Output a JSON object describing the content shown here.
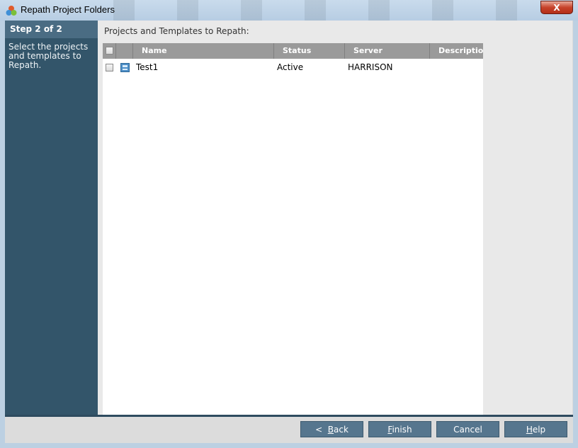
{
  "window": {
    "title": "Repath Project Folders",
    "close_label": "X"
  },
  "sidebar": {
    "step": "Step 2 of 2",
    "description": "Select the projects and templates to Repath."
  },
  "main": {
    "section_label": "Projects and Templates to Repath:",
    "columns": [
      "Name",
      "Status",
      "Server",
      "Description"
    ],
    "rows": [
      {
        "name": "Test1",
        "status": "Active",
        "server": "HARRISON",
        "description": "",
        "checked": false
      }
    ]
  },
  "buttons": {
    "back": {
      "prefix": "<",
      "mnemonic": "B",
      "rest": "ack"
    },
    "finish": {
      "mnemonic": "F",
      "rest": "inish"
    },
    "cancel": {
      "label": "Cancel"
    },
    "help": {
      "mnemonic": "H",
      "rest": "elp"
    }
  },
  "colors": {
    "sidebar": "#33556a",
    "step_header": "#4a6c83",
    "button": "#56768e",
    "grid_header": "#9a9a9a",
    "close_button": "#c7432b"
  },
  "icons": [
    "app-icon",
    "close-icon",
    "project-icon"
  ]
}
